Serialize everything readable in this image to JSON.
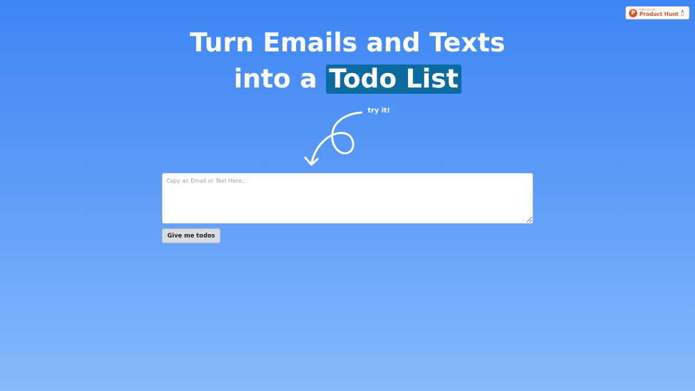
{
  "badge": {
    "small_text": "FIND US ON",
    "name": "Product Hunt",
    "logo_letter": "P",
    "arrow": "▲",
    "count": "12",
    "brand_color": "#da552f"
  },
  "headline": {
    "line1": "Turn Emails and Texts",
    "line2_prefix": "into a",
    "highlight": "Todo List",
    "highlight_color": "#0b6aa0"
  },
  "annotation": {
    "label": "try it!",
    "icon": "curly-arrow-icon"
  },
  "input": {
    "placeholder": "Copy an Email or Text Here...",
    "value": ""
  },
  "submit": {
    "label": "Give me todos"
  }
}
